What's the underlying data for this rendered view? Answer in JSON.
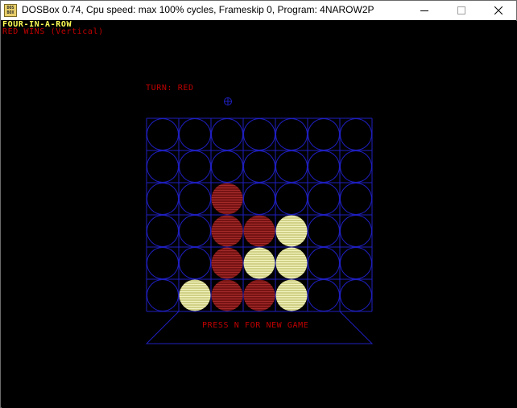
{
  "window": {
    "title": "DOSBox 0.74, Cpu speed: max 100% cycles, Frameskip  0, Program: 4NAROW2P",
    "icon_label": "DOS BOX",
    "buttons": [
      "minimize-icon",
      "maximize-icon",
      "close-icon"
    ]
  },
  "game": {
    "title": "FOUR-IN-A-ROW",
    "status": "RED WINS (Vertical)",
    "turn": "TURN: RED",
    "cursor_column": 3,
    "prompt": "PRESS N FOR NEW GAME",
    "columns": 7,
    "rows": 6,
    "grid": [
      [
        ".",
        ".",
        ".",
        ".",
        ".",
        ".",
        "."
      ],
      [
        ".",
        ".",
        ".",
        ".",
        ".",
        ".",
        "."
      ],
      [
        ".",
        ".",
        "R",
        ".",
        ".",
        ".",
        "."
      ],
      [
        ".",
        ".",
        "R",
        "R",
        "Y",
        ".",
        "."
      ],
      [
        ".",
        ".",
        "R",
        "Y",
        "Y",
        ".",
        "."
      ],
      [
        ".",
        "Y",
        "R",
        "R",
        "Y",
        ".",
        "."
      ]
    ]
  },
  "colors": {
    "grid_blue": "#1f1fbf",
    "red_piece": "#8b1a1a",
    "yellow_piece": "#e6e6a0",
    "text_red": "#c00000",
    "text_yellow": "#ffff55"
  }
}
